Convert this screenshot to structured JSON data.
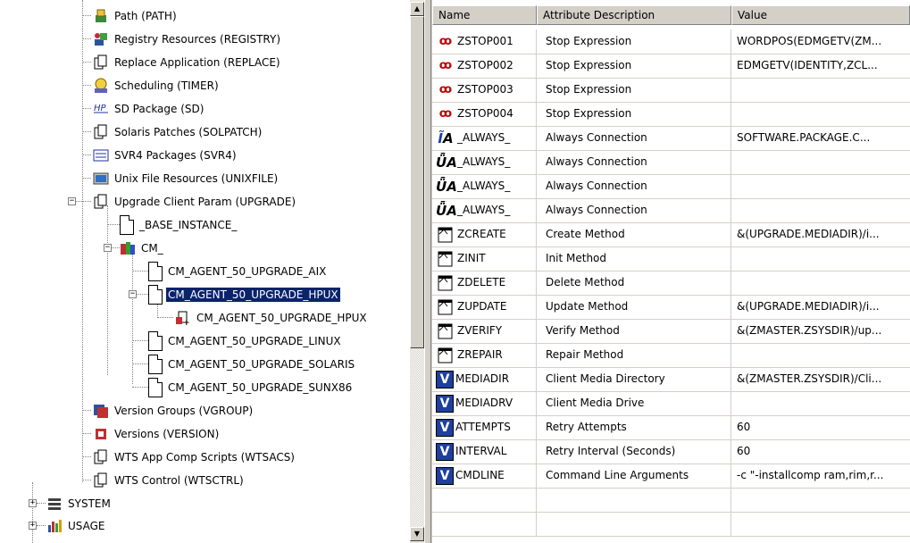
{
  "tree": {
    "nodes": [
      {
        "label": "Path (PATH)",
        "icon": "path-icon"
      },
      {
        "label": "Registry Resources (REGISTRY)",
        "icon": "registry-icon"
      },
      {
        "label": "Replace Application (REPLACE)",
        "icon": "class-icon"
      },
      {
        "label": "Scheduling (TIMER)",
        "icon": "scheduling-icon"
      },
      {
        "label": "SD Package (SD)",
        "icon": "hp-sd-icon"
      },
      {
        "label": "Solaris Patches (SOLPATCH)",
        "icon": "class-icon"
      },
      {
        "label": "SVR4 Packages (SVR4)",
        "icon": "svr4-icon"
      },
      {
        "label": "Unix File Resources (UNIXFILE)",
        "icon": "unixfile-icon"
      },
      {
        "label": "Upgrade Client Param (UPGRADE)",
        "icon": "class-icon"
      },
      {
        "label": "_BASE_INSTANCE_",
        "icon": "instance-icon"
      },
      {
        "label": "CM_",
        "icon": "cm-folder-icon"
      },
      {
        "label": "CM_AGENT_50_UPGRADE_AIX",
        "icon": "instance-icon"
      },
      {
        "label": "CM_AGENT_50_UPGRADE_HPUX",
        "icon": "instance-icon"
      },
      {
        "label": "CM_AGENT_50_UPGRADE_HPUX",
        "icon": "connection-icon"
      },
      {
        "label": "CM_AGENT_50_UPGRADE_LINUX",
        "icon": "instance-icon"
      },
      {
        "label": "CM_AGENT_50_UPGRADE_SOLARIS",
        "icon": "instance-icon"
      },
      {
        "label": "CM_AGENT_50_UPGRADE_SUNX86",
        "icon": "instance-icon"
      },
      {
        "label": "Version Groups (VGROUP)",
        "icon": "version-group-icon"
      },
      {
        "label": "Versions (VERSION)",
        "icon": "version-icon"
      },
      {
        "label": "WTS App Comp Scripts (WTSACS)",
        "icon": "class-icon"
      },
      {
        "label": "WTS Control (WTSCTRL)",
        "icon": "class-icon"
      },
      {
        "label": "SYSTEM",
        "icon": "system-icon"
      },
      {
        "label": "USAGE",
        "icon": "usage-icon"
      }
    ]
  },
  "list": {
    "headers": {
      "name": "Name",
      "description": "Attribute Description",
      "value": "Value"
    },
    "rows": [
      {
        "icon": "expression-icon",
        "name": "ZSTOP001",
        "description": "Stop Expression",
        "value": "WORDPOS(EDMGETV(ZM..."
      },
      {
        "icon": "expression-icon",
        "name": "ZSTOP002",
        "description": "Stop Expression",
        "value": "EDMGETV(IDENTITY,ZCL..."
      },
      {
        "icon": "expression-icon",
        "name": "ZSTOP003",
        "description": "Stop Expression",
        "value": ""
      },
      {
        "icon": "expression-icon",
        "name": "ZSTOP004",
        "description": "Stop Expression",
        "value": ""
      },
      {
        "icon": "connection-set-icon",
        "name": "_ALWAYS_",
        "description": "Always Connection",
        "value": "SOFTWARE.PACKAGE.C..."
      },
      {
        "icon": "connection-icon",
        "name": "_ALWAYS_",
        "description": "Always Connection",
        "value": ""
      },
      {
        "icon": "connection-icon",
        "name": "_ALWAYS_",
        "description": "Always Connection",
        "value": ""
      },
      {
        "icon": "connection-icon",
        "name": "_ALWAYS_",
        "description": "Always Connection",
        "value": ""
      },
      {
        "icon": "method-icon",
        "name": "ZCREATE",
        "description": "Create Method",
        "value": "&(UPGRADE.MEDIADIR)/i..."
      },
      {
        "icon": "method-icon",
        "name": "ZINIT",
        "description": "Init Method",
        "value": ""
      },
      {
        "icon": "method-icon",
        "name": "ZDELETE",
        "description": "Delete Method",
        "value": ""
      },
      {
        "icon": "method-icon",
        "name": "ZUPDATE",
        "description": "Update Method",
        "value": "&(UPGRADE.MEDIADIR)/i..."
      },
      {
        "icon": "method-icon",
        "name": "ZVERIFY",
        "description": "Verify Method",
        "value": "&(ZMASTER.ZSYSDIR)/up..."
      },
      {
        "icon": "method-icon",
        "name": "ZREPAIR",
        "description": "Repair Method",
        "value": ""
      },
      {
        "icon": "variable-icon",
        "name": "MEDIADIR",
        "description": "Client Media Directory",
        "value": "&(ZMASTER.ZSYSDIR)/Cli..."
      },
      {
        "icon": "variable-icon",
        "name": "MEDIADRV",
        "description": "Client Media Drive",
        "value": ""
      },
      {
        "icon": "variable-icon",
        "name": "ATTEMPTS",
        "description": "Retry Attempts",
        "value": "60"
      },
      {
        "icon": "variable-icon",
        "name": "INTERVAL",
        "description": "Retry Interval (Seconds)",
        "value": "60"
      },
      {
        "icon": "variable-icon",
        "name": "CMDLINE",
        "description": "Command Line Arguments",
        "value": "-c \"-installcomp ram,rim,r..."
      }
    ]
  },
  "colors": {
    "selection": "#0a246a",
    "variable_icon": "#1f3f9f",
    "expression_icon": "#c00000"
  }
}
